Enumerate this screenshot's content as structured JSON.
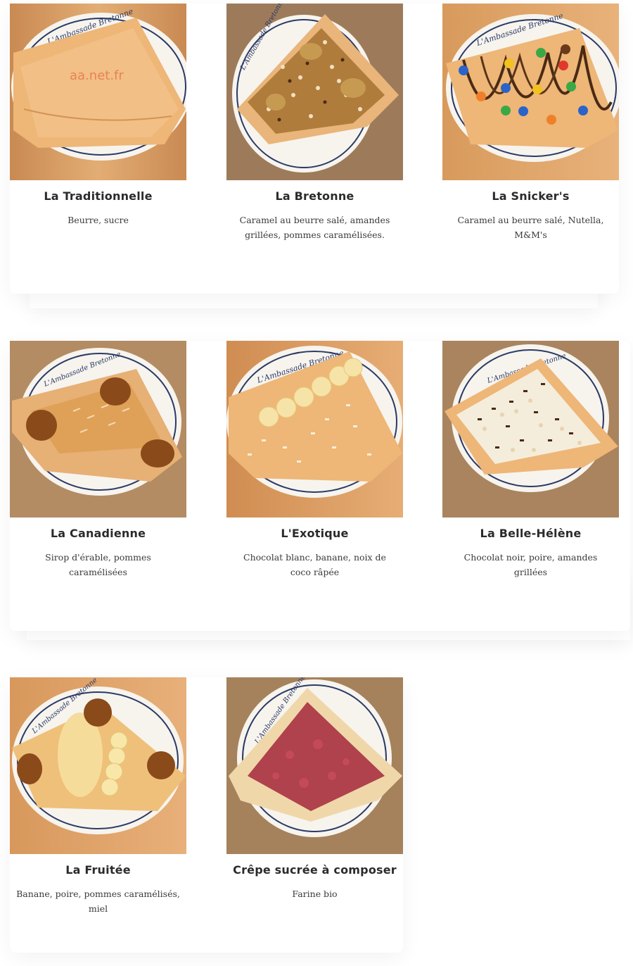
{
  "watermark": "aa.net.fr",
  "rows": [
    {
      "cards": [
        {
          "title": "La Traditionnelle",
          "description": "Beurre, sucre",
          "plate_text": "L'Ambassade Bretonne",
          "image_alt": "crepe-traditionnelle-photo"
        },
        {
          "title": "La Bretonne",
          "description": "Caramel au beurre salé, amandes grillées, pommes caramélisées.",
          "plate_text": "L'Ambassade Bretonne",
          "image_alt": "crepe-bretonne-photo"
        },
        {
          "title": "La Snicker's",
          "description": "Caramel au beurre salé, Nutella, M&M's",
          "plate_text": "L'Ambassade Bretonne",
          "image_alt": "crepe-snickers-photo"
        }
      ]
    },
    {
      "cards": [
        {
          "title": "La Canadienne",
          "description": "Sirop d'érable, pommes caramélisées",
          "plate_text": "L'Ambassade Bretonne",
          "image_alt": "crepe-canadienne-photo"
        },
        {
          "title": "L'Exotique",
          "description": "Chocolat blanc, banane, noix de coco râpée",
          "plate_text": "L'Ambassade Bretonne",
          "image_alt": "crepe-exotique-photo"
        },
        {
          "title": "La Belle-Hélène",
          "description": "Chocolat noir, poire, amandes grillées",
          "plate_text": "L'Ambassade Bretonne",
          "image_alt": "crepe-belle-helene-photo"
        }
      ]
    },
    {
      "cards": [
        {
          "title": "La Fruitée",
          "description": "Banane, poire, pommes caramélisés, miel",
          "plate_text": "L'Ambassade Bretonne",
          "image_alt": "crepe-fruitee-photo"
        },
        {
          "title": "Crêpe sucrée à composer",
          "description": "Farine bio",
          "plate_text": "L'Ambassade Bretonne",
          "image_alt": "crepe-a-composer-photo"
        }
      ]
    }
  ],
  "colors": {
    "wood_light": "#d9a46c",
    "wood_dark": "#a87a52",
    "plate": "#f5f2ec",
    "plate_rim": "#2b3a66",
    "crepe": "#eeb677",
    "caramel": "#b8731d",
    "chocolate": "#4a2a14",
    "jam": "#a3283c"
  }
}
